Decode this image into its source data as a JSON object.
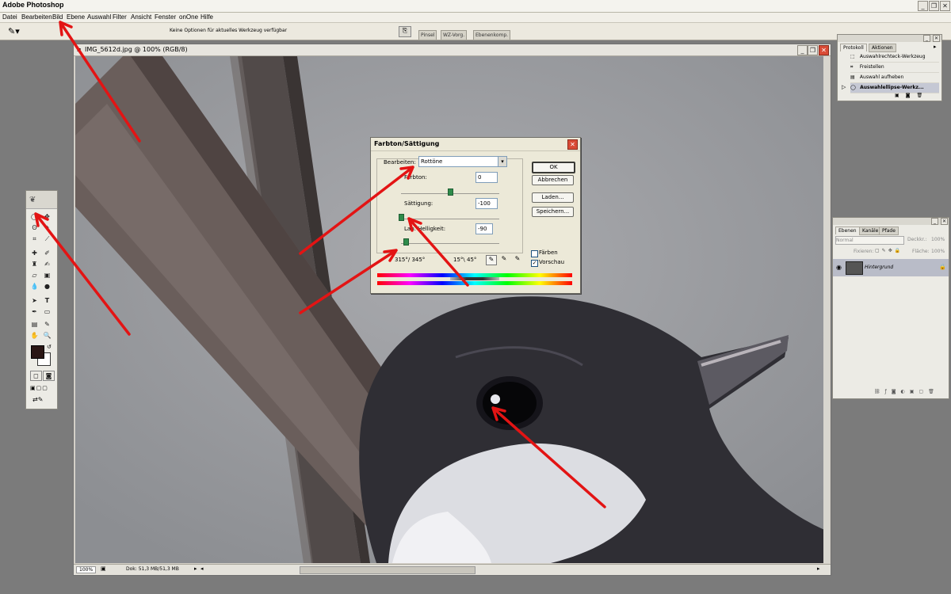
{
  "app": {
    "title": "Adobe Photoshop"
  },
  "menu": [
    "Datei",
    "Bearbeiten",
    "Bild",
    "Ebene",
    "Auswahl",
    "Filter",
    "Ansicht",
    "Fenster",
    "onOne",
    "Hilfe"
  ],
  "options": {
    "hint": "Keine Optionen für aktuelles Werkzeug verfügbar",
    "tabs": [
      "Pinsel",
      "WZ-Vorg.",
      "Ebenenkomp."
    ]
  },
  "document": {
    "title": "IMG_5612d.jpg @ 100% (RGB/8)",
    "zoom": "100%",
    "doc_info": "Dok: 51,3 MB/51,3 MB"
  },
  "dialog": {
    "title": "Farbton/Sättigung",
    "edit_label": "Bearbeiten:",
    "edit_value": "Rottöne",
    "hue_label": "Farbton:",
    "hue_value": "0",
    "hue_pos": 0.5,
    "sat_label": "Sättigung:",
    "sat_value": "-100",
    "sat_pos": 0.0,
    "light_label": "Lab. Helligkeit:",
    "light_value": "-90",
    "light_pos": 0.05,
    "range_left": "315°/ 345°",
    "range_right": "15°\\ 45°",
    "ok": "OK",
    "cancel": "Abbrechen",
    "load": "Laden...",
    "save": "Speichern...",
    "colorize": "Färben",
    "preview": "Vorschau",
    "colorize_checked": false,
    "preview_checked": true
  },
  "history": {
    "tabs": [
      "Protokoll",
      "Aktionen"
    ],
    "items": [
      "Auswahlrechteck-Werkzeug",
      "Freistellen",
      "Auswahl aufheben",
      "Auswahlellipse-Werkz..."
    ]
  },
  "layers": {
    "tabs": [
      "Ebenen",
      "Kanäle",
      "Pfade"
    ],
    "blend": "Normal",
    "opacity_label": "Deckkr.:",
    "opacity": "100%",
    "lock_label": "Fixieren:",
    "fill_label": "Fläche:",
    "fill": "100%",
    "layer_name": "Hintergrund"
  },
  "colors": {
    "foreground": "#2a1614",
    "background": "#ffffff",
    "annotation": "#e31414"
  }
}
